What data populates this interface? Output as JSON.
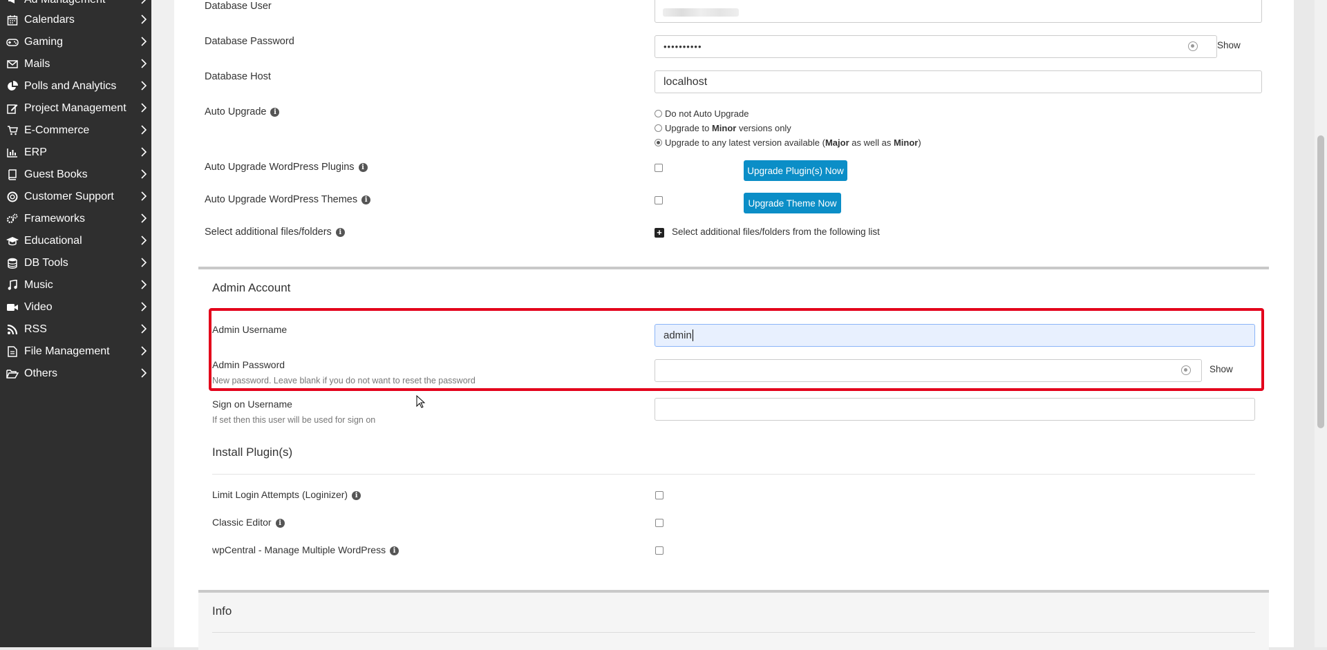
{
  "sidebar": {
    "items": [
      {
        "label": "Ad Management",
        "icon": "megaphone-icon"
      },
      {
        "label": "Calendars",
        "icon": "calendar-icon"
      },
      {
        "label": "Gaming",
        "icon": "gamepad-icon"
      },
      {
        "label": "Mails",
        "icon": "envelope-icon"
      },
      {
        "label": "Polls and Analytics",
        "icon": "pie-chart-icon"
      },
      {
        "label": "Project Management",
        "icon": "edit-icon"
      },
      {
        "label": "E-Commerce",
        "icon": "cart-icon"
      },
      {
        "label": "ERP",
        "icon": "bar-chart-icon"
      },
      {
        "label": "Guest Books",
        "icon": "book-icon"
      },
      {
        "label": "Customer Support",
        "icon": "lifebuoy-icon"
      },
      {
        "label": "Frameworks",
        "icon": "gears-icon"
      },
      {
        "label": "Educational",
        "icon": "graduation-cap-icon"
      },
      {
        "label": "DB Tools",
        "icon": "database-icon"
      },
      {
        "label": "Music",
        "icon": "music-icon"
      },
      {
        "label": "Video",
        "icon": "video-icon"
      },
      {
        "label": "RSS",
        "icon": "rss-icon"
      },
      {
        "label": "File Management",
        "icon": "file-icon"
      },
      {
        "label": "Others",
        "icon": "folder-open-icon"
      }
    ]
  },
  "db": {
    "user_label": "Database User",
    "password_label": "Database Password",
    "password_value": "••••••••••",
    "host_label": "Database Host",
    "host_value": "localhost",
    "show_label": "Show"
  },
  "auto_upgrade": {
    "label": "Auto Upgrade",
    "opt1": "Do not Auto Upgrade",
    "opt2_pre": "Upgrade to ",
    "opt2_bold": "Minor",
    "opt2_post": " versions only",
    "opt3_pre": "Upgrade to any latest version available (",
    "opt3_b1": "Major",
    "opt3_mid": " as well as ",
    "opt3_b2": "Minor",
    "opt3_post": ")",
    "selected": 3
  },
  "plugins_upgrade": {
    "label": "Auto Upgrade WordPress Plugins",
    "button": "Upgrade Plugin(s) Now"
  },
  "themes_upgrade": {
    "label": "Auto Upgrade WordPress Themes",
    "button": "Upgrade Theme Now"
  },
  "additional": {
    "label": "Select additional files/folders",
    "action": "Select additional files/folders from the following list"
  },
  "admin": {
    "section_title": "Admin Account",
    "username_label": "Admin Username",
    "username_value": "admin",
    "password_label": "Admin Password",
    "password_hint": "New password. Leave blank if you do not want to reset the password",
    "show_label": "Show",
    "signon_label": "Sign on Username",
    "signon_hint": "If set then this user will be used for sign on"
  },
  "install_plugins": {
    "section_title": "Install Plugin(s)",
    "items": [
      {
        "label": "Limit Login Attempts (Loginizer)"
      },
      {
        "label": "Classic Editor"
      },
      {
        "label": "wpCentral - Manage Multiple WordPress"
      }
    ]
  },
  "info": {
    "section_title": "Info"
  },
  "colors": {
    "sidebar_bg": "#2f2f2f",
    "button_blue": "#0b8ec7",
    "highlight_red": "#e3001b"
  }
}
